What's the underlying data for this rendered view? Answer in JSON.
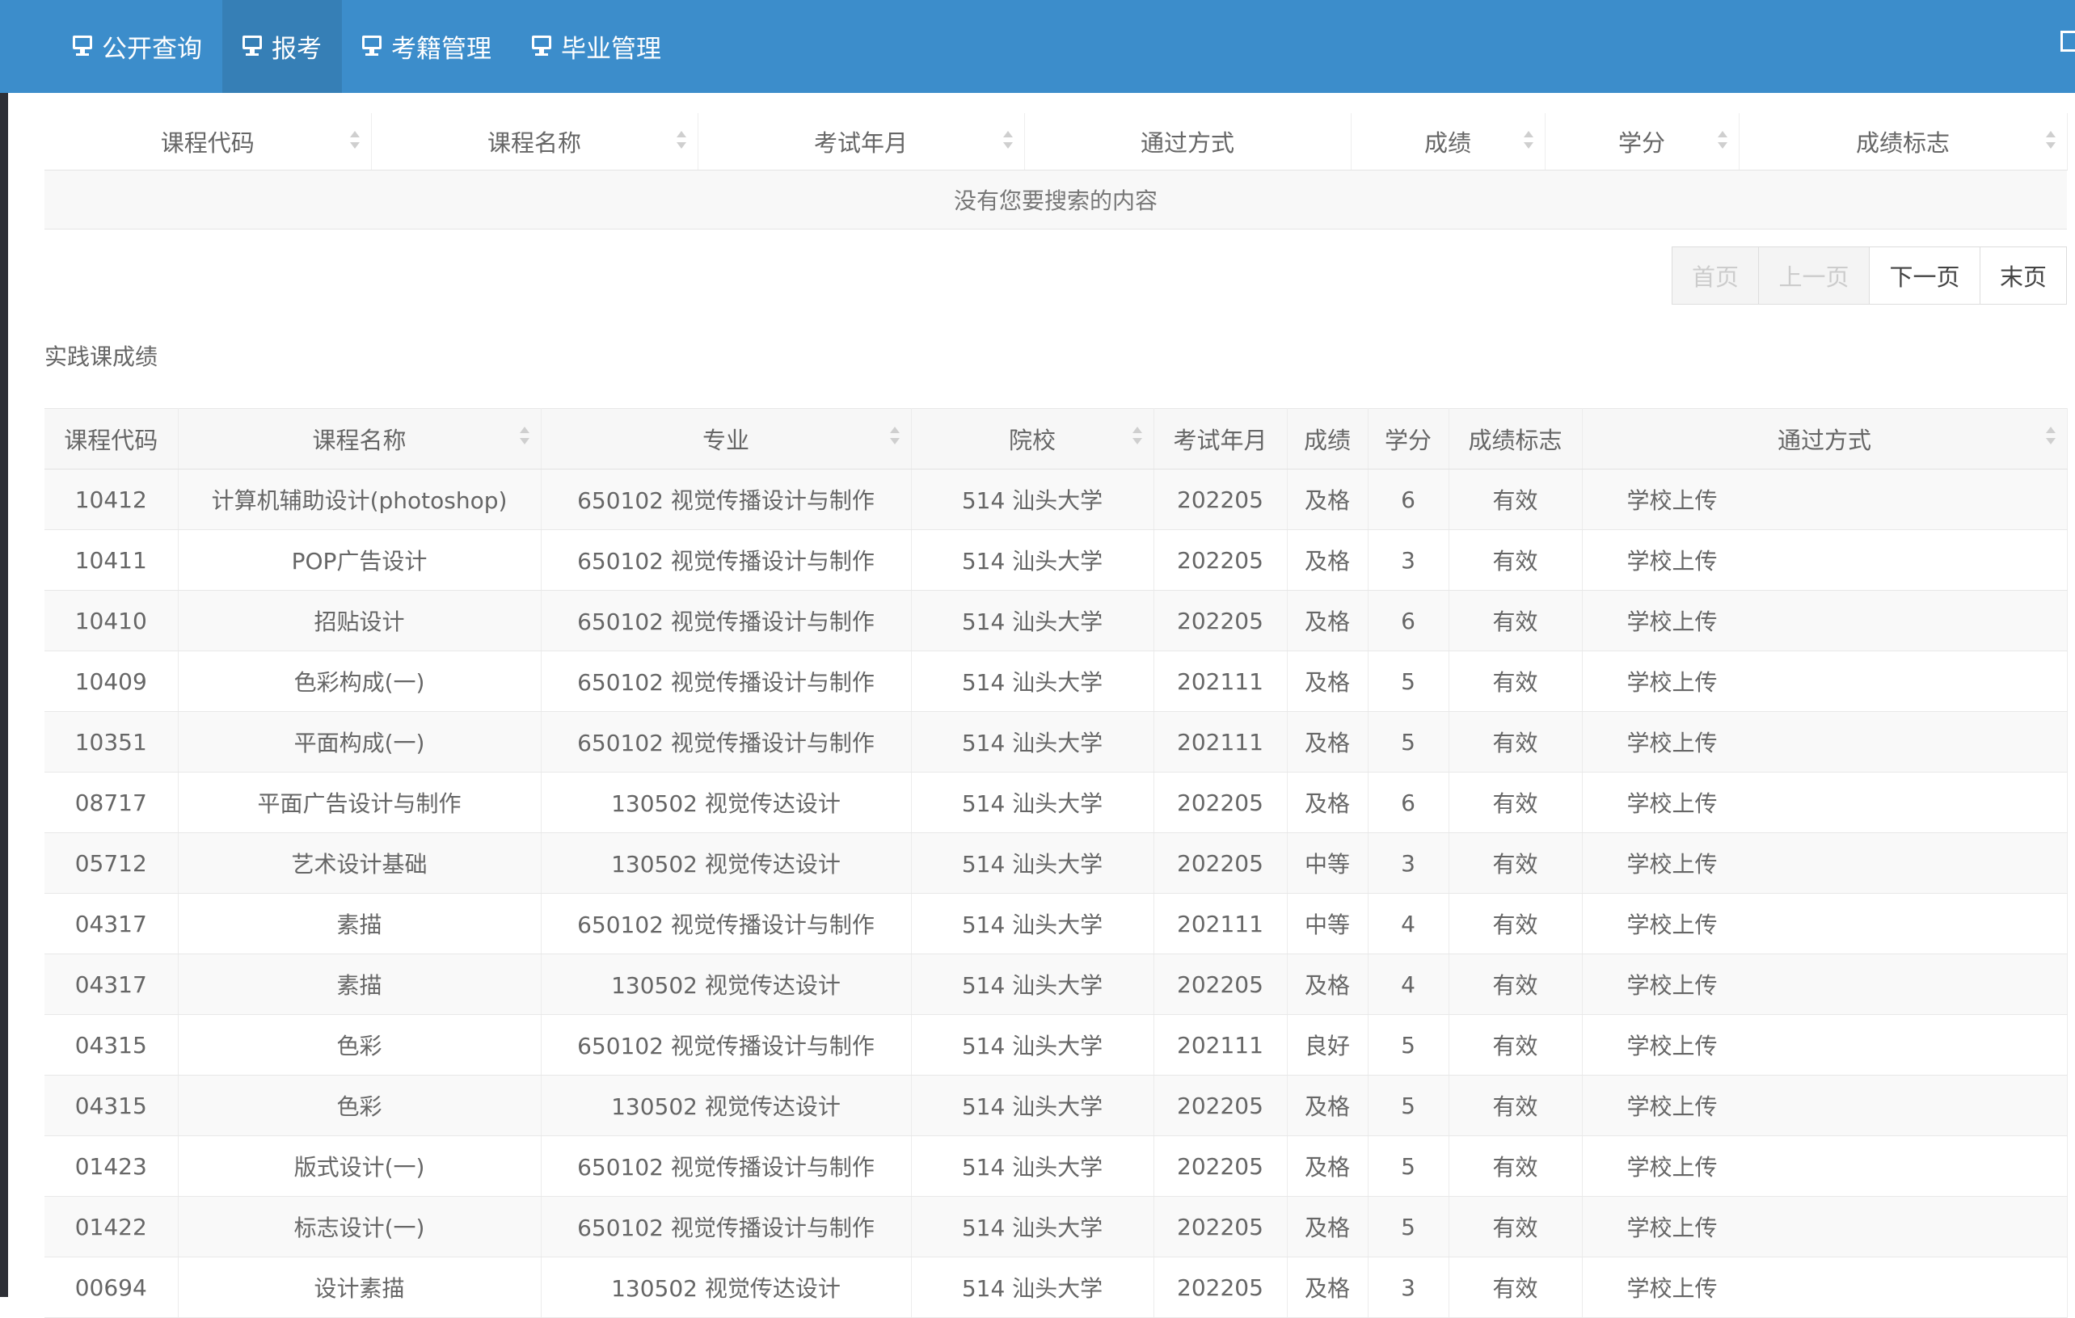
{
  "nav": {
    "items": [
      {
        "label": "公开查询",
        "active": false
      },
      {
        "label": "报考",
        "active": true
      },
      {
        "label": "考籍管理",
        "active": false
      },
      {
        "label": "毕业管理",
        "active": false
      }
    ],
    "accent_color": "#3c8dcb"
  },
  "search_table": {
    "headers": [
      "课程代码",
      "课程名称",
      "考试年月",
      "通过方式",
      "成绩",
      "学分",
      "成绩标志"
    ],
    "empty_message": "没有您要搜索的内容"
  },
  "pagination": {
    "first": "首页",
    "prev": "上一页",
    "next": "下一页",
    "last": "末页"
  },
  "practice": {
    "title": "实践课成绩",
    "headers": [
      "课程代码",
      "课程名称",
      "专业",
      "院校",
      "考试年月",
      "成绩",
      "学分",
      "成绩标志",
      "通过方式"
    ],
    "rows": [
      [
        "10412",
        "计算机辅助设计(photoshop)",
        "650102 视觉传播设计与制作",
        "514 汕头大学",
        "202205",
        "及格",
        "6",
        "有效",
        "学校上传"
      ],
      [
        "10411",
        "POP广告设计",
        "650102 视觉传播设计与制作",
        "514 汕头大学",
        "202205",
        "及格",
        "3",
        "有效",
        "学校上传"
      ],
      [
        "10410",
        "招贴设计",
        "650102 视觉传播设计与制作",
        "514 汕头大学",
        "202205",
        "及格",
        "6",
        "有效",
        "学校上传"
      ],
      [
        "10409",
        "色彩构成(一)",
        "650102 视觉传播设计与制作",
        "514 汕头大学",
        "202111",
        "及格",
        "5",
        "有效",
        "学校上传"
      ],
      [
        "10351",
        "平面构成(一)",
        "650102 视觉传播设计与制作",
        "514 汕头大学",
        "202111",
        "及格",
        "5",
        "有效",
        "学校上传"
      ],
      [
        "08717",
        "平面广告设计与制作",
        "130502 视觉传达设计",
        "514 汕头大学",
        "202205",
        "及格",
        "6",
        "有效",
        "学校上传"
      ],
      [
        "05712",
        "艺术设计基础",
        "130502 视觉传达设计",
        "514 汕头大学",
        "202205",
        "中等",
        "3",
        "有效",
        "学校上传"
      ],
      [
        "04317",
        "素描",
        "650102 视觉传播设计与制作",
        "514 汕头大学",
        "202111",
        "中等",
        "4",
        "有效",
        "学校上传"
      ],
      [
        "04317",
        "素描",
        "130502 视觉传达设计",
        "514 汕头大学",
        "202205",
        "及格",
        "4",
        "有效",
        "学校上传"
      ],
      [
        "04315",
        "色彩",
        "650102 视觉传播设计与制作",
        "514 汕头大学",
        "202111",
        "良好",
        "5",
        "有效",
        "学校上传"
      ],
      [
        "04315",
        "色彩",
        "130502 视觉传达设计",
        "514 汕头大学",
        "202205",
        "及格",
        "5",
        "有效",
        "学校上传"
      ],
      [
        "01423",
        "版式设计(一)",
        "650102 视觉传播设计与制作",
        "514 汕头大学",
        "202205",
        "及格",
        "5",
        "有效",
        "学校上传"
      ],
      [
        "01422",
        "标志设计(一)",
        "650102 视觉传播设计与制作",
        "514 汕头大学",
        "202205",
        "及格",
        "5",
        "有效",
        "学校上传"
      ],
      [
        "00694",
        "设计素描",
        "130502 视觉传达设计",
        "514 汕头大学",
        "202205",
        "及格",
        "3",
        "有效",
        "学校上传"
      ]
    ]
  }
}
